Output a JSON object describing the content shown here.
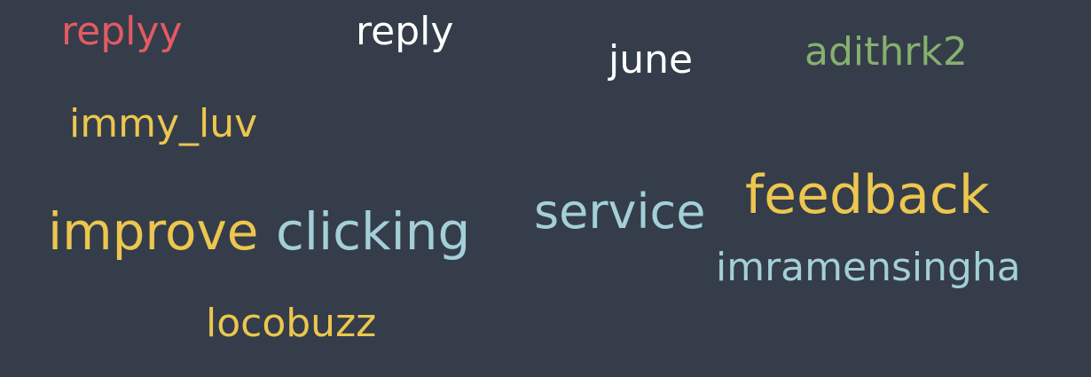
{
  "colors": {
    "background": "#353d4a",
    "red": "#e45a63",
    "white": "#ffffff",
    "green": "#86b06f",
    "yellow": "#ecc64e",
    "lightblue": "#a3cfd8"
  },
  "words": [
    {
      "text": "replyy",
      "color": "#e45a63"
    },
    {
      "text": "reply",
      "color": "#ffffff"
    },
    {
      "text": "june",
      "color": "#ffffff"
    },
    {
      "text": "adithrk2",
      "color": "#86b06f"
    },
    {
      "text": "immy_luv",
      "color": "#ecc64e"
    },
    {
      "text": "improve",
      "color": "#ecc64e"
    },
    {
      "text": "clicking",
      "color": "#a3cfd8"
    },
    {
      "text": "service",
      "color": "#a3cfd8"
    },
    {
      "text": "feedback",
      "color": "#ecc64e"
    },
    {
      "text": "imramensingha",
      "color": "#a3cfd8"
    },
    {
      "text": "locobuzz",
      "color": "#ecc64e"
    }
  ]
}
